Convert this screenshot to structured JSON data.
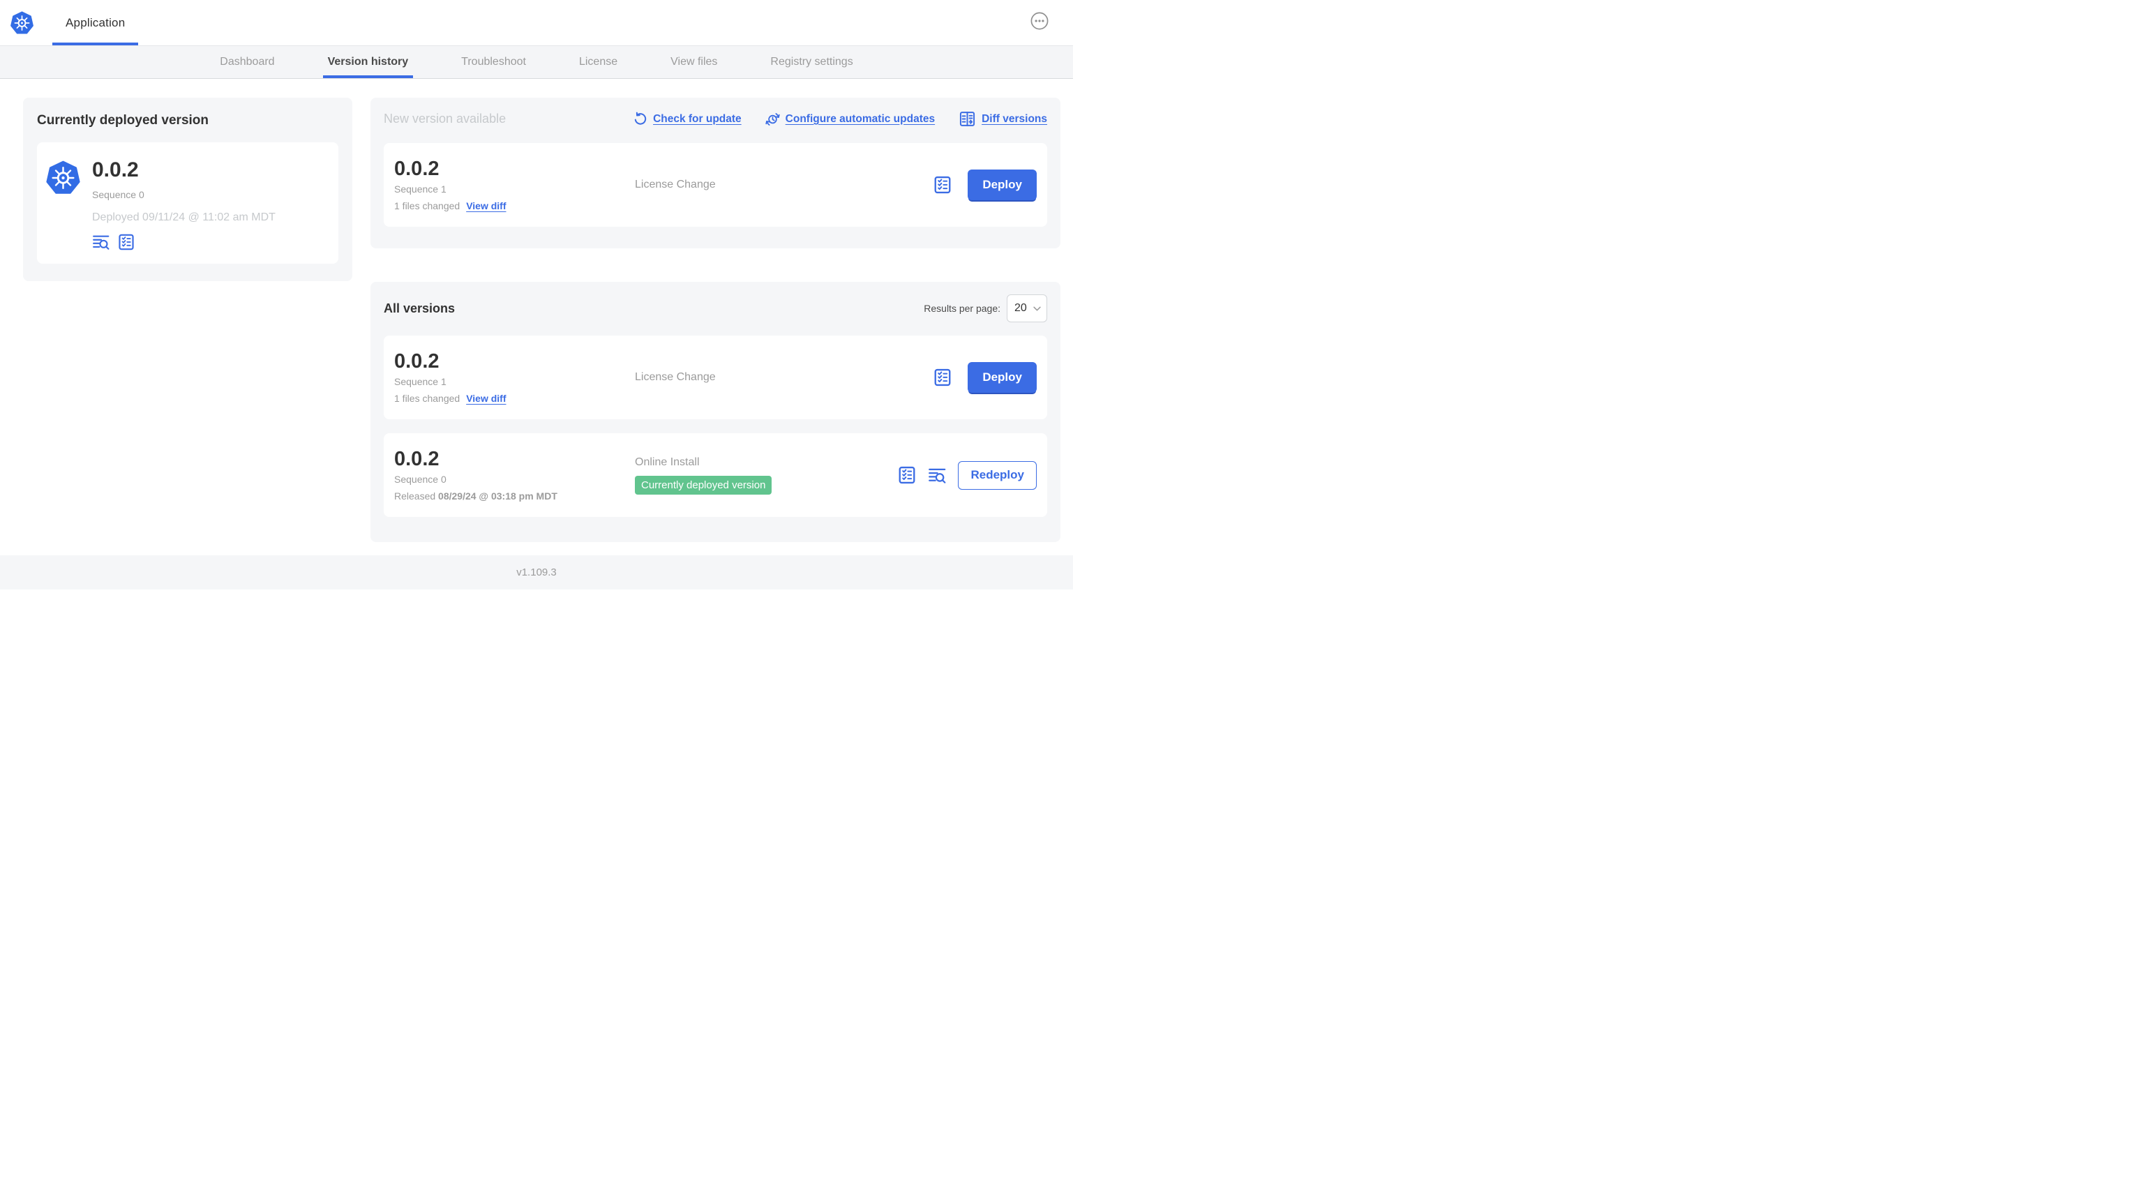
{
  "colors": {
    "primary_blue": "#3b6ce4",
    "kubernetes_blue": "#326ce5",
    "badge_green": "#61c48e",
    "panel_gray": "#f5f6f8"
  },
  "header": {
    "app_title": "Application"
  },
  "nav": {
    "tabs": [
      {
        "label": "Dashboard"
      },
      {
        "label": "Version history"
      },
      {
        "label": "Troubleshoot"
      },
      {
        "label": "License"
      },
      {
        "label": "View files"
      },
      {
        "label": "Registry settings"
      }
    ]
  },
  "current_deployed": {
    "title": "Currently deployed version",
    "version": "0.0.2",
    "sequence": "Sequence 0",
    "deployed": "Deployed 09/11/24 @ 11:02 am MDT"
  },
  "new_version": {
    "title": "New version available",
    "check_for_update": "Check for update",
    "configure_automatic_updates": "Configure automatic updates",
    "diff_versions": "Diff versions",
    "row": {
      "version": "0.0.2",
      "sequence": "Sequence 1",
      "files_changed": "1 files changed",
      "view_diff": "View diff",
      "source": "License Change",
      "deploy_label": "Deploy"
    }
  },
  "all_versions": {
    "title": "All versions",
    "results_per_page_label": "Results per page:",
    "results_per_page_value": "20",
    "rows": [
      {
        "version": "0.0.2",
        "sequence": "Sequence 1",
        "files_changed": "1 files changed",
        "view_diff": "View diff",
        "source": "License Change",
        "deploy_label": "Deploy"
      },
      {
        "version": "0.0.2",
        "sequence": "Sequence 0",
        "released_prefix": "Released ",
        "released_date": "08/29/24 @ 03:18 pm MDT",
        "source": "Online Install",
        "badge": "Currently deployed version",
        "redeploy_label": "Redeploy"
      }
    ]
  },
  "footer": {
    "app_version": "v1.109.3"
  }
}
